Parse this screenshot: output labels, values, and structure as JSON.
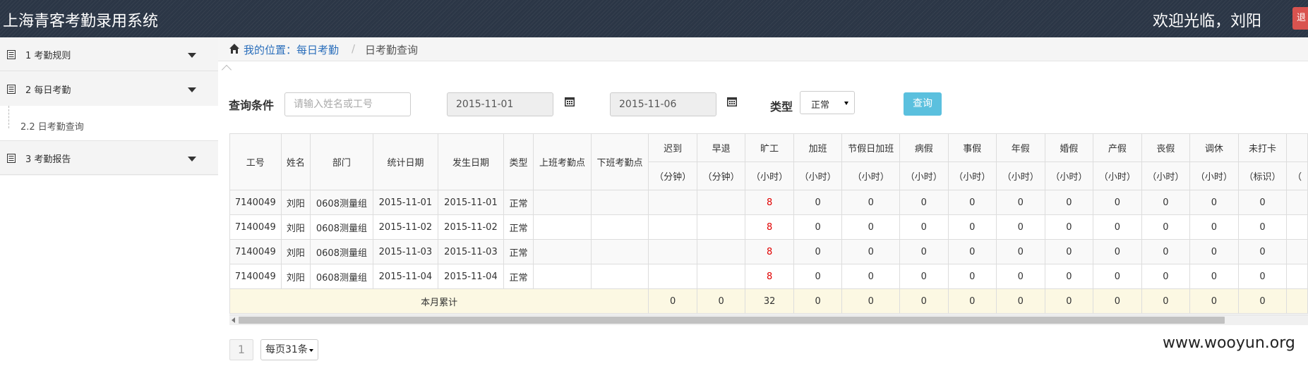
{
  "app": {
    "title": "上海青客考勤录用系统",
    "welcome": "欢迎光临，刘阳",
    "logout_label": "退"
  },
  "sidebar": {
    "items": [
      {
        "label": "1 考勤规则"
      },
      {
        "label": "2 每日考勤"
      },
      {
        "label": "3 考勤报告"
      }
    ],
    "sub_item": {
      "label": "2.2 日考勤查询"
    }
  },
  "breadcrumb": {
    "location": "我的位置：每日考勤",
    "separator": "/",
    "current": "日考勤查询"
  },
  "query": {
    "label": "查询条件",
    "name_placeholder": "请输入姓名或工号",
    "date_from": "2015-11-01",
    "date_to": "2015-11-06",
    "type_label": "类型",
    "type_value": "正常",
    "search_label": "查询"
  },
  "table": {
    "columns_main": [
      "工号",
      "姓名",
      "部门",
      "统计日期",
      "发生日期",
      "类型",
      "上班考勤点",
      "下班考勤点"
    ],
    "columns_stat": [
      {
        "name": "迟到",
        "unit": "（分钟）"
      },
      {
        "name": "早退",
        "unit": "（分钟）"
      },
      {
        "name": "旷工",
        "unit": "（小时）"
      },
      {
        "name": "加班",
        "unit": "（小时）"
      },
      {
        "name": "节假日加班",
        "unit": "（小时）"
      },
      {
        "name": "病假",
        "unit": "（小时）"
      },
      {
        "name": "事假",
        "unit": "（小时）"
      },
      {
        "name": "年假",
        "unit": "（小时）"
      },
      {
        "name": "婚假",
        "unit": "（小时）"
      },
      {
        "name": "产假",
        "unit": "（小时）"
      },
      {
        "name": "丧假",
        "unit": "（小时）"
      },
      {
        "name": "调休",
        "unit": "（小时）"
      },
      {
        "name": "未打卡",
        "unit": "（标识）"
      },
      {
        "name": "",
        "unit": "（"
      }
    ],
    "rows": [
      {
        "id": "7140049",
        "name": "刘阳",
        "dept": "0608测量组",
        "stat_date": "2015-11-01",
        "occur_date": "2015-11-01",
        "type": "正常",
        "in_point": "",
        "out_point": "",
        "stats": [
          "",
          "",
          "8",
          "0",
          "0",
          "0",
          "0",
          "0",
          "0",
          "0",
          "0",
          "0",
          "0",
          ""
        ]
      },
      {
        "id": "7140049",
        "name": "刘阳",
        "dept": "0608测量组",
        "stat_date": "2015-11-02",
        "occur_date": "2015-11-02",
        "type": "正常",
        "in_point": "",
        "out_point": "",
        "stats": [
          "",
          "",
          "8",
          "0",
          "0",
          "0",
          "0",
          "0",
          "0",
          "0",
          "0",
          "0",
          "0",
          ""
        ]
      },
      {
        "id": "7140049",
        "name": "刘阳",
        "dept": "0608测量组",
        "stat_date": "2015-11-03",
        "occur_date": "2015-11-03",
        "type": "正常",
        "in_point": "",
        "out_point": "",
        "stats": [
          "",
          "",
          "8",
          "0",
          "0",
          "0",
          "0",
          "0",
          "0",
          "0",
          "0",
          "0",
          "0",
          ""
        ]
      },
      {
        "id": "7140049",
        "name": "刘阳",
        "dept": "0608测量组",
        "stat_date": "2015-11-04",
        "occur_date": "2015-11-04",
        "type": "正常",
        "in_point": "",
        "out_point": "",
        "stats": [
          "",
          "",
          "8",
          "0",
          "0",
          "0",
          "0",
          "0",
          "0",
          "0",
          "0",
          "0",
          "0",
          ""
        ]
      }
    ],
    "total": {
      "label": "本月累计",
      "stats": [
        "0",
        "0",
        "32",
        "0",
        "0",
        "0",
        "0",
        "0",
        "0",
        "0",
        "0",
        "0",
        "0",
        ""
      ]
    }
  },
  "pager": {
    "page": "1",
    "page_size": "每页31条"
  },
  "colors": {
    "nav": "#2b3646",
    "link": "#2a6ebb",
    "absent": "#e10000",
    "search_button": "#5bc0de",
    "total_row": "#fcf8e3",
    "logout": "#d9534f"
  },
  "watermark": "www.wooyun.org"
}
